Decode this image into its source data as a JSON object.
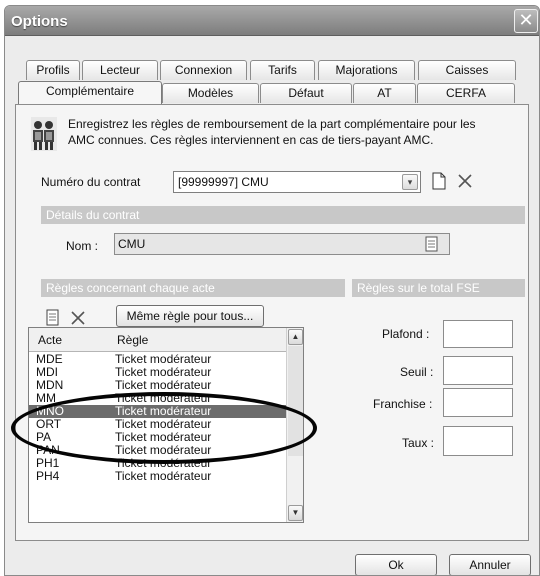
{
  "window": {
    "title": "Options",
    "close_glyph": "✕"
  },
  "tabs_back": [
    {
      "label": "Profils",
      "name": "tab-profils"
    },
    {
      "label": "Lecteur",
      "name": "tab-lecteur"
    },
    {
      "label": "Connexion",
      "name": "tab-connexion"
    },
    {
      "label": "Tarifs",
      "name": "tab-tarifs"
    },
    {
      "label": "Majorations",
      "name": "tab-majorations"
    },
    {
      "label": "Caisses",
      "name": "tab-caisses"
    }
  ],
  "tabs_front": [
    {
      "label": "Complémentaire",
      "name": "tab-complementaire",
      "active": true
    },
    {
      "label": "Modèles",
      "name": "tab-modeles"
    },
    {
      "label": "Défaut",
      "name": "tab-defaut"
    },
    {
      "label": "AT",
      "name": "tab-at"
    },
    {
      "label": "CERFA",
      "name": "tab-cerfa"
    }
  ],
  "intro": {
    "line1": "Enregistrez les règles de remboursement de la part complémentaire pour les",
    "line2": "AMC connues. Ces règles interviennent en cas de tiers-payant AMC."
  },
  "contract": {
    "label": "Numéro du contrat",
    "value": "[99999997] CMU"
  },
  "details": {
    "section_title": "Détails du contrat",
    "nom_label": "Nom :",
    "nom_value": "CMU"
  },
  "rules": {
    "section_title": "Règles concernant chaque acte",
    "same_rule_button": "Même règle pour tous...",
    "columns": {
      "acte": "Acte",
      "regle": "Règle"
    },
    "rows": [
      {
        "acte": "MDE",
        "regle": "Ticket modérateur"
      },
      {
        "acte": "MDI",
        "regle": "Ticket modérateur"
      },
      {
        "acte": "MDN",
        "regle": "Ticket modérateur"
      },
      {
        "acte": "MM",
        "regle": "Ticket modérateur"
      },
      {
        "acte": "MNO",
        "regle": "Ticket modérateur",
        "selected": true
      },
      {
        "acte": "ORT",
        "regle": "Ticket modérateur"
      },
      {
        "acte": "PA",
        "regle": "Ticket modérateur"
      },
      {
        "acte": "PAN",
        "regle": "Ticket modérateur"
      },
      {
        "acte": "PH1",
        "regle": "Ticket modérateur"
      },
      {
        "acte": "PH4",
        "regle": "Ticket modérateur"
      }
    ]
  },
  "totals": {
    "section_title": "Règles sur le total FSE",
    "plafond": "Plafond :",
    "seuil": "Seuil :",
    "franchise": "Franchise :",
    "taux": "Taux :"
  },
  "footer": {
    "ok": "Ok",
    "cancel": "Annuler"
  },
  "icons": {
    "dropdown": "▾",
    "scroll_up": "▲",
    "scroll_down": "▼"
  },
  "colors": {
    "selection": "#6c6c6c",
    "section_bar": "#c8c8c8",
    "highlight_ellipse": "#050505"
  }
}
